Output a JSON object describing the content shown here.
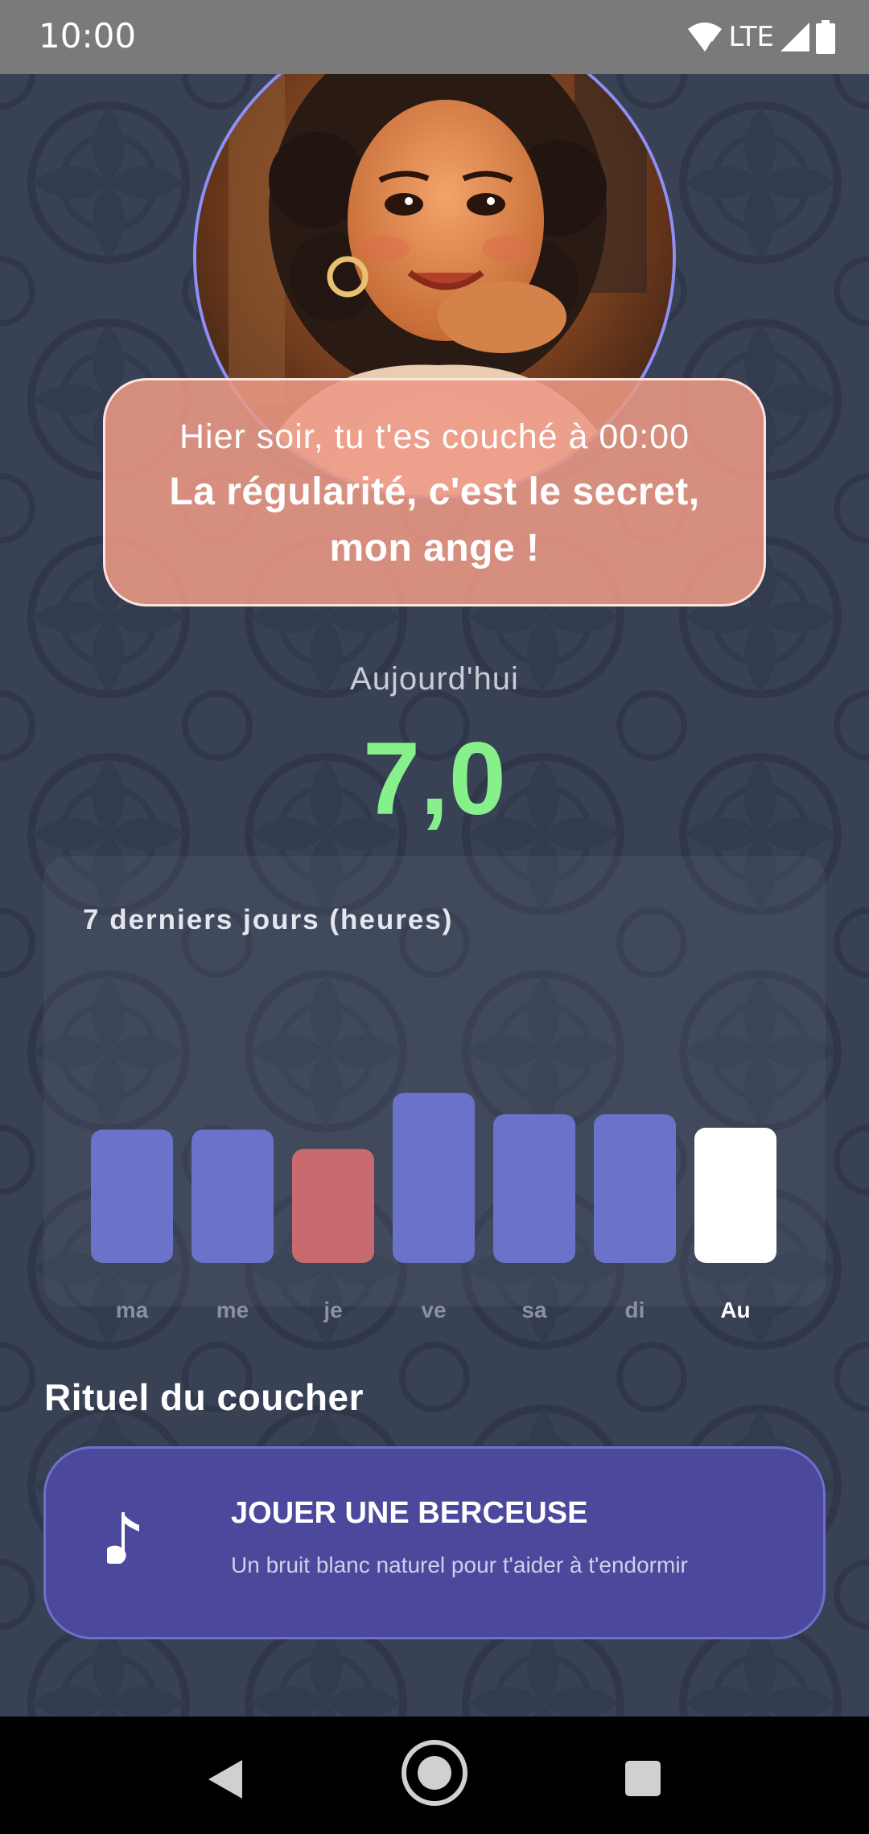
{
  "status_bar": {
    "time": "10:00",
    "network": "LTE",
    "icons": [
      "wifi-icon",
      "signal-icon",
      "battery-icon"
    ]
  },
  "avatar": {
    "description_icon": "avatar-portrait"
  },
  "message": {
    "line1": "Hier soir, tu t'es couché à 00:00",
    "line2a": "La régularité, c'est le secret,",
    "line2b": "mon ange !"
  },
  "today": {
    "label": "Aujourd'hui",
    "value": "7,0"
  },
  "chart_data": {
    "type": "bar",
    "title": "7 derniers jours (heures)",
    "categories": [
      "ma",
      "me",
      "je",
      "ve",
      "sa",
      "di",
      "Au"
    ],
    "values": [
      6.9,
      6.9,
      5.9,
      8.8,
      7.7,
      7.7,
      7.0
    ],
    "colors": [
      "#6b72c9",
      "#6b72c9",
      "#c96b6e",
      "#6b72c9",
      "#6b72c9",
      "#6b72c9",
      "#ffffff"
    ],
    "highlight_index": 6,
    "grid": false
  },
  "ritual": {
    "section_title": "Rituel du coucher",
    "button_title": "JOUER UNE BERCEUSE",
    "button_subtitle": "Un bruit blanc naturel pour t'aider à t'endormir",
    "icon": "music-note-icon"
  },
  "nav": {
    "icons": [
      "back-icon",
      "home-icon",
      "recents-icon"
    ]
  },
  "colors": {
    "accent_green": "#86f08a",
    "bubble": "#ec9884",
    "card_purple": "#4c489c"
  }
}
